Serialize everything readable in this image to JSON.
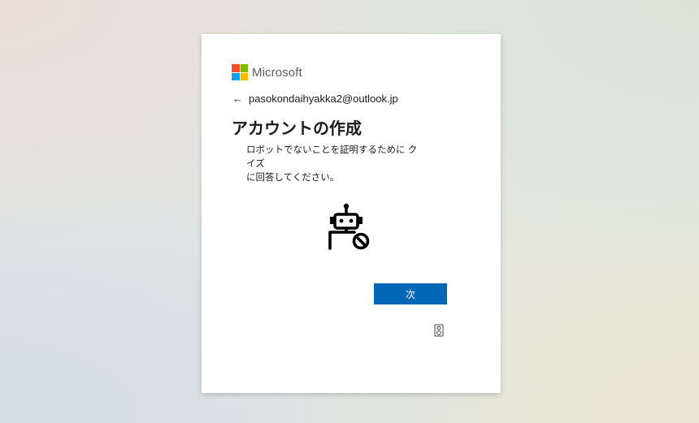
{
  "brand": {
    "name": "Microsoft",
    "logo_colors": [
      "#f25022",
      "#7fba00",
      "#00a4ef",
      "#ffb900"
    ]
  },
  "identity": {
    "back_icon": "back-arrow-icon",
    "email": "pasokondaihyakka2@outlook.jp"
  },
  "page": {
    "title": "アカウントの作成",
    "description_line1": "ロボットでないことを証明するために クイズ",
    "description_line2": "に回答してください。"
  },
  "illustration": {
    "icon": "robot-blocked-icon"
  },
  "actions": {
    "next_label": "次",
    "accent_color": "#0067b8",
    "audio_icon": "audio-challenge-icon"
  }
}
